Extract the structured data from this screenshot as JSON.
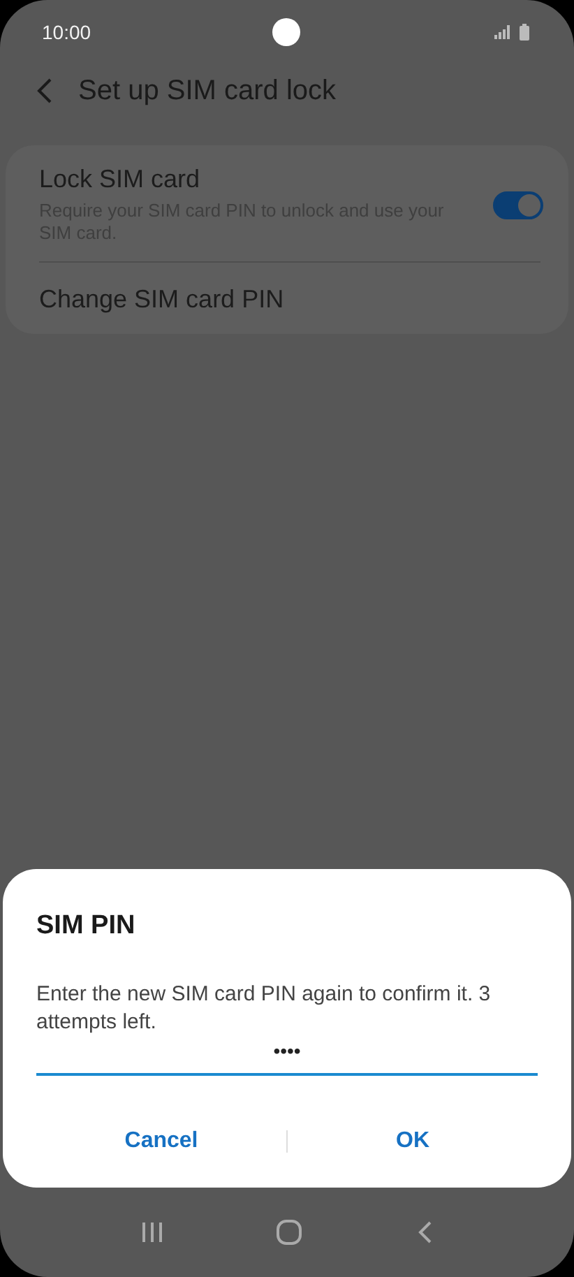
{
  "status_bar": {
    "time": "10:00"
  },
  "header": {
    "title": "Set up SIM card lock"
  },
  "settings": [
    {
      "kind": "toggle",
      "title": "Lock SIM card",
      "subtitle": "Require your SIM card PIN to unlock and use your SIM card.",
      "on": true
    },
    {
      "kind": "link",
      "title": "Change SIM card PIN"
    }
  ],
  "dialog": {
    "title": "SIM PIN",
    "message": "Enter the new SIM card PIN again to confirm it. 3 attempts left.",
    "field_value": "••••",
    "buttons": [
      "Cancel",
      "OK"
    ]
  }
}
